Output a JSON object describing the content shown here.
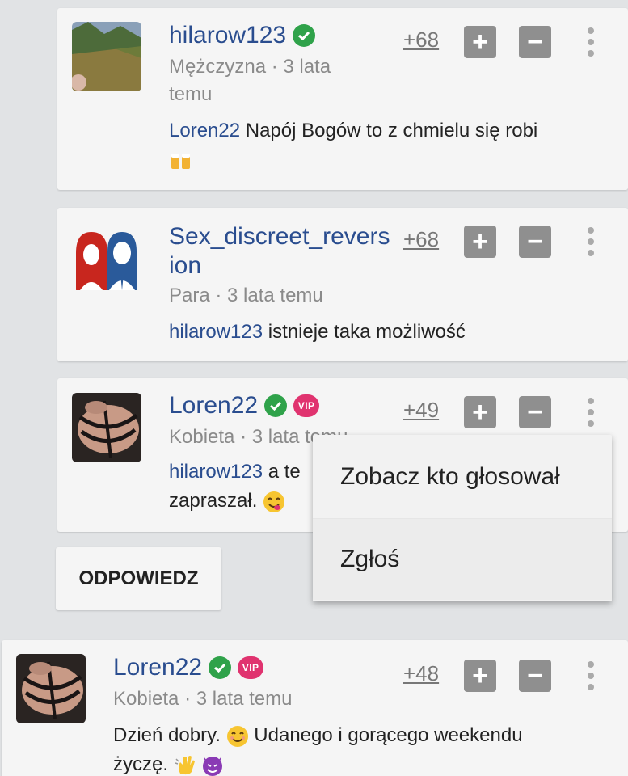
{
  "comments": [
    {
      "username": "hilarow123",
      "meta": "Mężczyzna · 3 lata temu",
      "score": "+68",
      "reply_to": "Loren22",
      "text": " Napój Bogów to z chmielu się robi"
    },
    {
      "username": "Sex_discreet_reversion",
      "meta": "Para · 3 lata temu",
      "score": "+68",
      "reply_to": "hilarow123",
      "text": " istnieje taka możliwość"
    },
    {
      "username": "Loren22",
      "vip": "VIP",
      "meta": "Kobieta · 3 lata temu",
      "score": "+49",
      "reply_to": "hilarow123",
      "text_line1": " a te",
      "text_line2": "zapraszał."
    },
    {
      "username": "Loren22",
      "vip": "VIP",
      "meta": "Kobieta · 3 lata temu",
      "score": "+48",
      "text_line1": "Dzień dobry. ",
      "text_line1b": " Udanego i gorącego weekendu",
      "text_line2": "życzę. "
    }
  ],
  "vote": {
    "plus": "+",
    "minus": "−"
  },
  "reply_button_label": "ODPOWIEDZ",
  "context_menu": {
    "items": [
      "Zobacz kto głosował",
      "Zgłoś"
    ]
  },
  "icons": {
    "verified": "verified-check-icon",
    "vip": "vip-badge-icon",
    "more": "kebab-menu-icon",
    "beer": "beer-emoji-icon",
    "yum": "yum-emoji-icon",
    "smile": "smile-emoji-icon",
    "wave": "wave-emoji-icon",
    "devil": "devil-emoji-icon"
  },
  "colors": {
    "username": "#2a4d8f",
    "verified": "#2fa24a",
    "vip": "#e0336f",
    "vote_button": "#8f8f8f"
  }
}
